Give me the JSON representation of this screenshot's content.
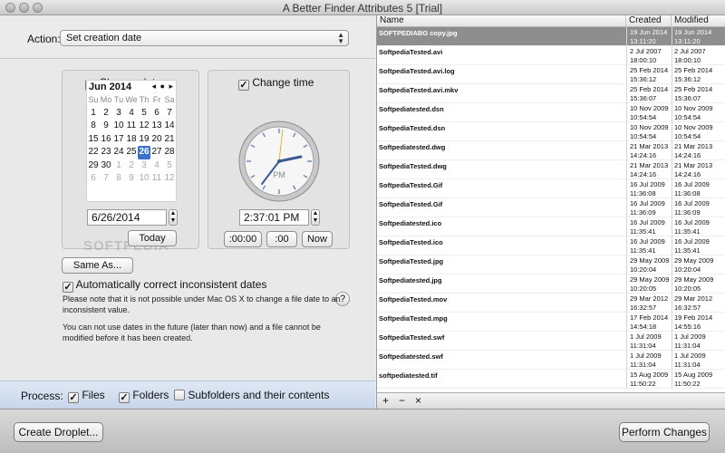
{
  "window": {
    "title": "A Better Finder Attributes 5 [Trial]"
  },
  "action": {
    "label": "Action:",
    "value": "Set creation date"
  },
  "date": {
    "checkbox_label": "Change date",
    "checked": true,
    "month_label": "Jun 2014",
    "weekdays": [
      "Su",
      "Mo",
      "Tu",
      "We",
      "Th",
      "Fr",
      "Sa"
    ],
    "weeks": [
      [
        "1",
        "2",
        "3",
        "4",
        "5",
        "6",
        "7"
      ],
      [
        "8",
        "9",
        "10",
        "11",
        "12",
        "13",
        "14"
      ],
      [
        "15",
        "16",
        "17",
        "18",
        "19",
        "20",
        "21"
      ],
      [
        "22",
        "23",
        "24",
        "25",
        "26",
        "27",
        "28"
      ],
      [
        "29",
        "30",
        "1",
        "2",
        "3",
        "4",
        "5"
      ],
      [
        "6",
        "7",
        "8",
        "9",
        "10",
        "11",
        "12"
      ]
    ],
    "selected_day": "26",
    "field_value": "6/26/2014",
    "today_button": "Today"
  },
  "time": {
    "checkbox_label": "Change time",
    "checked": true,
    "clock_period": "PM",
    "field_value": "2:37:01 PM",
    "btn_zero_min_sec": ":00:00",
    "btn_zero_sec": ":00",
    "btn_now": "Now"
  },
  "same_as_button": "Same As...",
  "auto_correct": {
    "label": "Automatically correct inconsistent dates",
    "checked": true
  },
  "notes": {
    "note1": "Please note that it is not possible under Mac OS X to change a file date to an inconsistent value.",
    "note2": "You can not use dates in the future (later than now) and a file cannot be modified before it has been created."
  },
  "help_glyph": "?",
  "process": {
    "label": "Process:",
    "files": {
      "label": "Files",
      "checked": true
    },
    "folders": {
      "label": "Folders",
      "checked": true
    },
    "subfolders": {
      "label": "Subfolders and their contents",
      "checked": false
    }
  },
  "table": {
    "columns": [
      "Name",
      "Created",
      "Modified"
    ],
    "rows": [
      {
        "name": "SOFTPEDIABG copy.jpg",
        "created": "19 Jun 2014\n13:11:20",
        "modified": "19 Jun 2014\n13:11:20",
        "selected": true
      },
      {
        "name": "SoftpediaTested.avi",
        "created": "2 Jul 2007\n18:00:10",
        "modified": "2 Jul 2007\n18:00:10",
        "selected": false
      },
      {
        "name": "SoftpediaTested.avi.log",
        "created": "25 Feb 2014\n15:36:12",
        "modified": "25 Feb 2014\n15:36:12",
        "selected": false
      },
      {
        "name": "SoftpediaTested.avi.mkv",
        "created": "25 Feb 2014\n15:36:07",
        "modified": "25 Feb 2014\n15:36:07",
        "selected": false
      },
      {
        "name": "Softpediatested.dsn",
        "created": "10 Nov 2009\n10:54:54",
        "modified": "10 Nov 2009\n10:54:54",
        "selected": false
      },
      {
        "name": "SoftpediaTested.dsn",
        "created": "10 Nov 2009\n10:54:54",
        "modified": "10 Nov 2009\n10:54:54",
        "selected": false
      },
      {
        "name": "Softpediatested.dwg",
        "created": "21 Mar 2013\n14:24:16",
        "modified": "21 Mar 2013\n14:24:16",
        "selected": false
      },
      {
        "name": "SoftpediaTested.dwg",
        "created": "21 Mar 2013\n14:24:16",
        "modified": "21 Mar 2013\n14:24:16",
        "selected": false
      },
      {
        "name": "SoftpediaTested.Gif",
        "created": "16 Jul 2009\n11:36:08",
        "modified": "16 Jul 2009\n11:36:08",
        "selected": false
      },
      {
        "name": "SoftpediaTested.Gif",
        "created": "16 Jul 2009\n11:36:09",
        "modified": "16 Jul 2009\n11:36:09",
        "selected": false
      },
      {
        "name": "Softpediatested.ico",
        "created": "16 Jul 2009\n11:35:41",
        "modified": "16 Jul 2009\n11:35:41",
        "selected": false
      },
      {
        "name": "SoftpediaTested.ico",
        "created": "16 Jul 2009\n11:35:41",
        "modified": "16 Jul 2009\n11:35:41",
        "selected": false
      },
      {
        "name": "SoftpediaTested.jpg",
        "created": "29 May 2009\n10:20:04",
        "modified": "29 May 2009\n10:20:04",
        "selected": false
      },
      {
        "name": "Softpediatested.jpg",
        "created": "29 May 2009\n10:20:05",
        "modified": "29 May 2009\n10:20:05",
        "selected": false
      },
      {
        "name": "SoftpediaTested.mov",
        "created": "29 Mar 2012\n16:32:57",
        "modified": "29 Mar 2012\n16:32:57",
        "selected": false
      },
      {
        "name": "SoftpediaTested.mpg",
        "created": "17 Feb 2014\n14:54:18",
        "modified": "19 Feb 2014\n14:55:16",
        "selected": false
      },
      {
        "name": "SoftpediaTested.swf",
        "created": "1 Jul 2009\n11:31:04",
        "modified": "1 Jul 2009\n11:31:04",
        "selected": false
      },
      {
        "name": "Softpediatested.swf",
        "created": "1 Jul 2009\n11:31:04",
        "modified": "1 Jul 2009\n11:31:04",
        "selected": false
      },
      {
        "name": "softpediatested.tif",
        "created": "15 Aug 2009\n11:50:22",
        "modified": "15 Aug 2009\n11:50:22",
        "selected": false
      }
    ]
  },
  "list_footer": {
    "add": "+",
    "remove": "−",
    "clear": "×"
  },
  "buttons": {
    "create_droplet": "Create Droplet...",
    "perform": "Perform Changes"
  },
  "watermark": "SOFTPEDIA"
}
